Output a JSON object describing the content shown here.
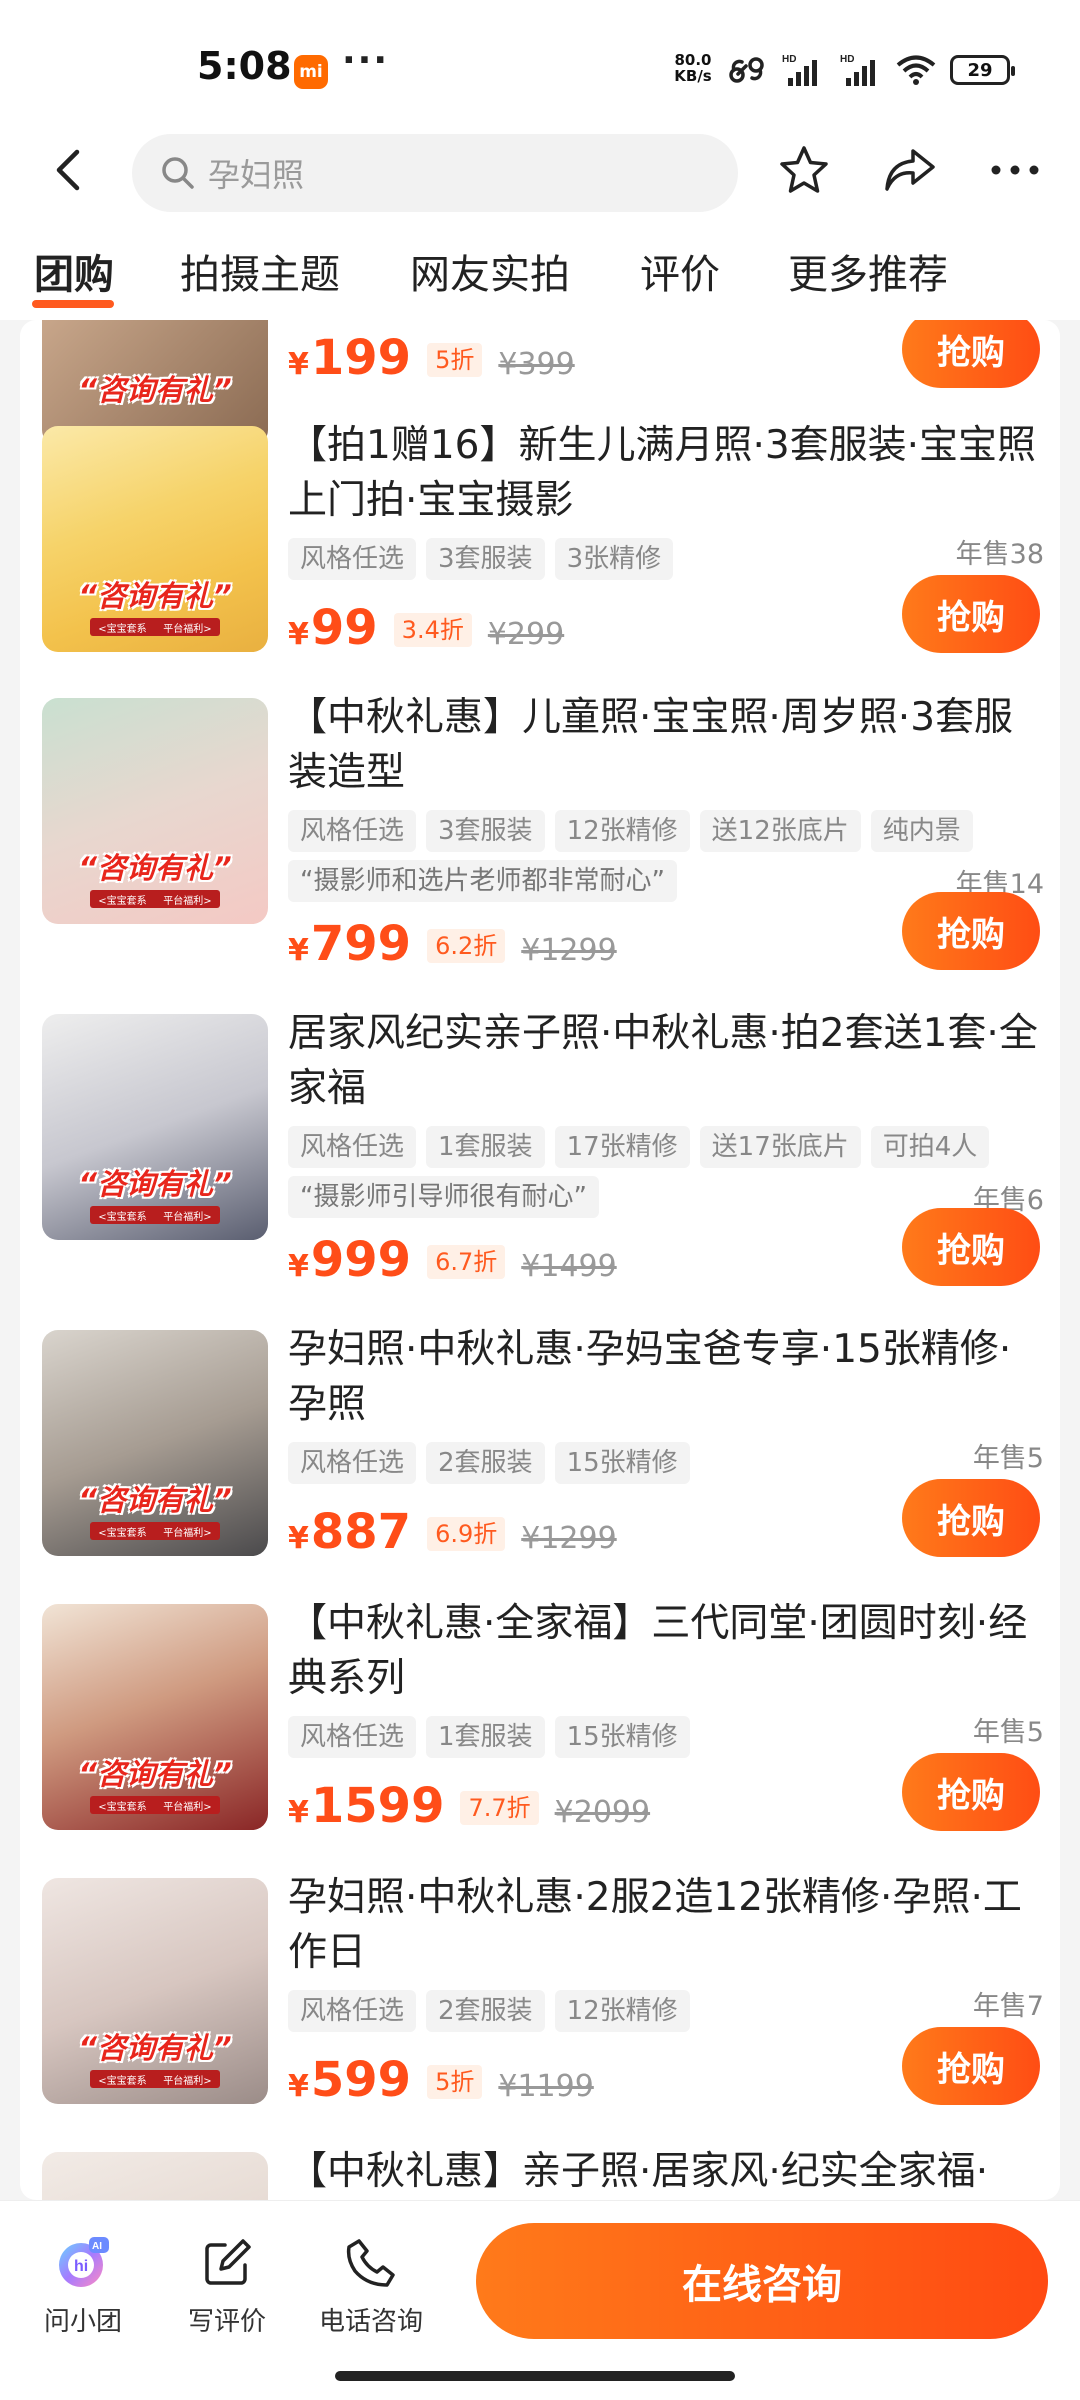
{
  "status_bar": {
    "time": "5:08",
    "app_badge": "mi",
    "more": "···",
    "net_speed": "80.0\nKB/s",
    "battery": "29"
  },
  "nav": {
    "search_placeholder": "孕妇照"
  },
  "tabs": [
    {
      "label": "团购",
      "active": true
    },
    {
      "label": "拍摄主题",
      "active": false
    },
    {
      "label": "网友实拍",
      "active": false
    },
    {
      "label": "评价",
      "active": false
    },
    {
      "label": "更多推荐",
      "active": false
    }
  ],
  "thumb_badge": "“咨询有礼”",
  "thumb_sub_a": "<宝宝套系",
  "thumb_sub_b": "平台福利>",
  "buy_label": "抢购",
  "items": [
    {
      "price": "199",
      "discount": "5折",
      "original": "¥399"
    },
    {
      "title": "【拍1赠16】新生儿满月照·3套服装·宝宝照上门拍·宝宝摄影",
      "tags": [
        "风格任选",
        "3套服装",
        "3张精修"
      ],
      "sold": "年售38",
      "price": "99",
      "discount": "3.4折",
      "original": "¥299"
    },
    {
      "title": "【中秋礼惠】儿童照·宝宝照·周岁照·3套服装造型",
      "tags": [
        "风格任选",
        "3套服装",
        "12张精修",
        "送12张底片",
        "纯内景"
      ],
      "quote": "“摄影师和选片老师都非常耐心”",
      "sold": "年售14",
      "price": "799",
      "discount": "6.2折",
      "original": "¥1299"
    },
    {
      "title": "居家风纪实亲子照·中秋礼惠·拍2套送1套·全家福",
      "tags": [
        "风格任选",
        "1套服装",
        "17张精修",
        "送17张底片",
        "可拍4人"
      ],
      "quote": "“摄影师引导师很有耐心”",
      "sold": "年售6",
      "price": "999",
      "discount": "6.7折",
      "original": "¥1499"
    },
    {
      "title": "孕妇照·中秋礼惠·孕妈宝爸专享·15张精修·孕照",
      "tags": [
        "风格任选",
        "2套服装",
        "15张精修"
      ],
      "sold": "年售5",
      "price": "887",
      "discount": "6.9折",
      "original": "¥1299"
    },
    {
      "title": "【中秋礼惠·全家福】三代同堂·团圆时刻·经典系列",
      "tags": [
        "风格任选",
        "1套服装",
        "15张精修"
      ],
      "sold": "年售5",
      "price": "1599",
      "discount": "7.7折",
      "original": "¥2099"
    },
    {
      "title": "孕妇照·中秋礼惠·2服2造12张精修·孕照·工作日",
      "tags": [
        "风格任选",
        "2套服装",
        "12张精修"
      ],
      "sold": "年售7",
      "price": "599",
      "discount": "5折",
      "original": "¥1199"
    },
    {
      "title": "【中秋礼惠】亲子照·居家风·纪实全家福·"
    }
  ],
  "bottom_bar": {
    "ask": "问小团",
    "review": "写评价",
    "phone": "电话咨询",
    "consult": "在线咨询"
  },
  "colors": {
    "accent": "#ff5a1f",
    "price": "#ff4d18"
  }
}
